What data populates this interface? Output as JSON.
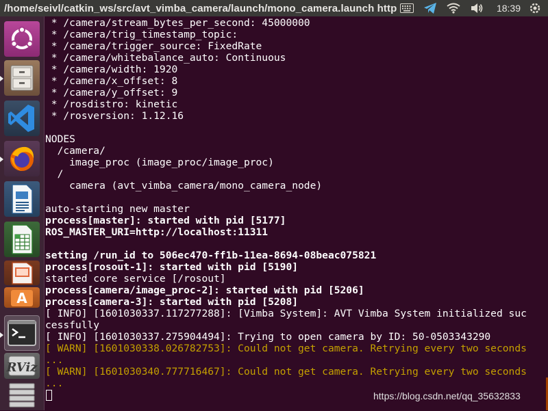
{
  "window": {
    "title": "/home/seivl/catkin_ws/src/avt_vimba_camera/launch/mono_camera.launch http"
  },
  "tray": {
    "clock": "18:39"
  },
  "terminal": {
    "lines": [
      {
        "text": " * /camera/stream_bytes_per_second: 45000000",
        "style": "normal"
      },
      {
        "text": " * /camera/trig_timestamp_topic: ",
        "style": "normal"
      },
      {
        "text": " * /camera/trigger_source: FixedRate",
        "style": "normal"
      },
      {
        "text": " * /camera/whitebalance_auto: Continuous",
        "style": "normal"
      },
      {
        "text": " * /camera/width: 1920",
        "style": "normal"
      },
      {
        "text": " * /camera/x_offset: 8",
        "style": "normal"
      },
      {
        "text": " * /camera/y_offset: 9",
        "style": "normal"
      },
      {
        "text": " * /rosdistro: kinetic",
        "style": "normal"
      },
      {
        "text": " * /rosversion: 1.12.16",
        "style": "normal"
      },
      {
        "text": "",
        "style": "normal"
      },
      {
        "text": "NODES",
        "style": "normal"
      },
      {
        "text": "  /camera/",
        "style": "normal"
      },
      {
        "text": "    image_proc (image_proc/image_proc)",
        "style": "normal"
      },
      {
        "text": "  /",
        "style": "normal"
      },
      {
        "text": "    camera (avt_vimba_camera/mono_camera_node)",
        "style": "normal"
      },
      {
        "text": "",
        "style": "normal"
      },
      {
        "text": "auto-starting new master",
        "style": "normal"
      },
      {
        "text": "process[master]: started with pid [5177]",
        "style": "bold"
      },
      {
        "text": "ROS_MASTER_URI=http://localhost:11311",
        "style": "bold"
      },
      {
        "text": "",
        "style": "normal"
      },
      {
        "text": "setting /run_id to 506ec470-ff1b-11ea-8694-08beac075821",
        "style": "bold"
      },
      {
        "text": "process[rosout-1]: started with pid [5190]",
        "style": "bold"
      },
      {
        "text": "started core service [/rosout]",
        "style": "normal"
      },
      {
        "text": "process[camera/image_proc-2]: started with pid [5206]",
        "style": "bold"
      },
      {
        "text": "process[camera-3]: started with pid [5208]",
        "style": "bold"
      },
      {
        "text": "[ INFO] [1601030337.117277288]: [Vimba System]: AVT Vimba System initialized suc",
        "style": "normal"
      },
      {
        "text": "cessfully",
        "style": "normal"
      },
      {
        "text": "[ INFO] [1601030337.275904494]: Trying to open camera by ID: 50-0503343290",
        "style": "normal"
      },
      {
        "text": "[ WARN] [1601030338.026782753]: Could not get camera. Retrying every two seconds",
        "style": "warn"
      },
      {
        "text": "...",
        "style": "warn"
      },
      {
        "text": "[ WARN] [1601030340.777716467]: Could not get camera. Retrying every two seconds",
        "style": "warn"
      },
      {
        "text": "...",
        "style": "warn"
      }
    ]
  },
  "launcher": {
    "items": [
      {
        "name": "ubuntu-dash-icon",
        "active": false
      },
      {
        "name": "file-cabinet-icon",
        "active": true
      },
      {
        "name": "vscode-icon",
        "active": false
      },
      {
        "name": "firefox-icon",
        "active": true
      },
      {
        "name": "libreoffice-writer-icon",
        "active": false
      },
      {
        "name": "libreoffice-calc-icon",
        "active": false
      },
      {
        "name": "libreoffice-impress-icon",
        "active": false
      },
      {
        "name": "software-center-icon",
        "active": false
      },
      {
        "name": "terminal-icon",
        "active": true
      },
      {
        "name": "rviz-icon",
        "active": false
      },
      {
        "name": "workspace-stack-icon",
        "active": false
      }
    ]
  },
  "watermark": "https://blog.csdn.net/qq_35632833",
  "colors": {
    "terminal_bg": "#300a24",
    "warn": "#c4a000",
    "topbar": "#3a3a37"
  }
}
